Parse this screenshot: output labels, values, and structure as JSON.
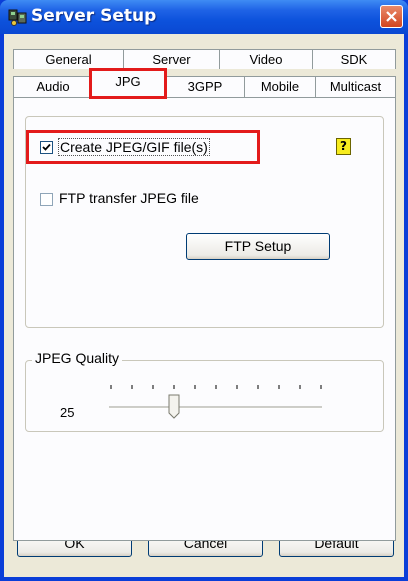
{
  "window": {
    "title": "Server Setup"
  },
  "tabs_row1": [
    "General",
    "Server",
    "Video",
    "SDK"
  ],
  "tabs_row2": [
    "Audio",
    "JPG",
    "3GPP",
    "Mobile",
    "Multicast"
  ],
  "active_tab": "JPG",
  "jpg": {
    "create_label": "Create JPEG/GIF file(s)",
    "create_checked": true,
    "ftp_label": "FTP transfer JPEG file",
    "ftp_checked": false,
    "ftp_setup_button": "FTP Setup",
    "help_glyph": "?"
  },
  "quality": {
    "legend": "JPEG Quality",
    "value": "25",
    "slider_fraction": 0.3
  },
  "buttons": {
    "ok": "OK",
    "cancel": "Cancel",
    "default": "Default"
  },
  "colors": {
    "highlight": "#e31b1b",
    "titlebar": "#0a48d2"
  }
}
